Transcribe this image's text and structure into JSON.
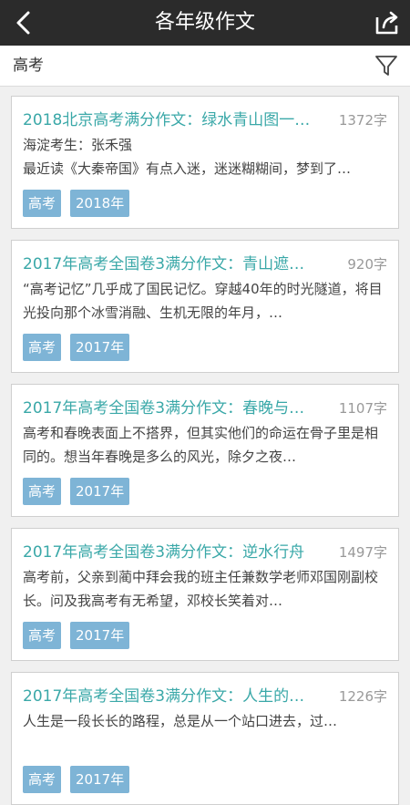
{
  "header": {
    "title": "各年级作文",
    "back_icon": "back-arrow-icon",
    "share_icon": "share-icon"
  },
  "filter": {
    "label": "高考",
    "filter_icon": "funnel-icon"
  },
  "articles": [
    {
      "title": "2018北京高考满分作文：绿水青山图一…",
      "word_count": "1372字",
      "snippet": "海淀考生：张禾强\n最近读《大秦帝国》有点入迷，迷迷糊糊间，梦到了…",
      "tags": [
        "高考",
        "2018年"
      ]
    },
    {
      "title": "2017年高考全国卷3满分作文：青山遮…",
      "word_count": "920字",
      "snippet": "“高考记忆”几乎成了国民记忆。穿越40年的时光隧道，将目光投向那个冰雪消融、生机无限的年月，…",
      "tags": [
        "高考",
        "2017年"
      ]
    },
    {
      "title": "2017年高考全国卷3满分作文：春晚与…",
      "word_count": "1107字",
      "snippet": "高考和春晚表面上不搭界，但其实他们的命运在骨子里是相同的。想当年春晚是多么的风光，除夕之夜…",
      "tags": [
        "高考",
        "2017年"
      ]
    },
    {
      "title": "2017年高考全国卷3满分作文：逆水行舟",
      "word_count": "1497字",
      "snippet": "高考前，父亲到蔺中拜会我的班主任兼数学老师邓国刚副校长。问及我高考有无希望，邓校长笑着对…",
      "tags": [
        "高考",
        "2017年"
      ]
    },
    {
      "title": "2017年高考全国卷3满分作文：人生的…",
      "word_count": "1226字",
      "snippet": "人生是一段长长的路程，总是从一个站口进去，过…",
      "tags": [
        "高考",
        "2017年"
      ]
    }
  ],
  "colors": {
    "header_bg": "#2b2b2b",
    "title_teal": "#3aa8a8",
    "tag_blue": "#7eb4d6",
    "page_bg": "#f0f0f0"
  }
}
